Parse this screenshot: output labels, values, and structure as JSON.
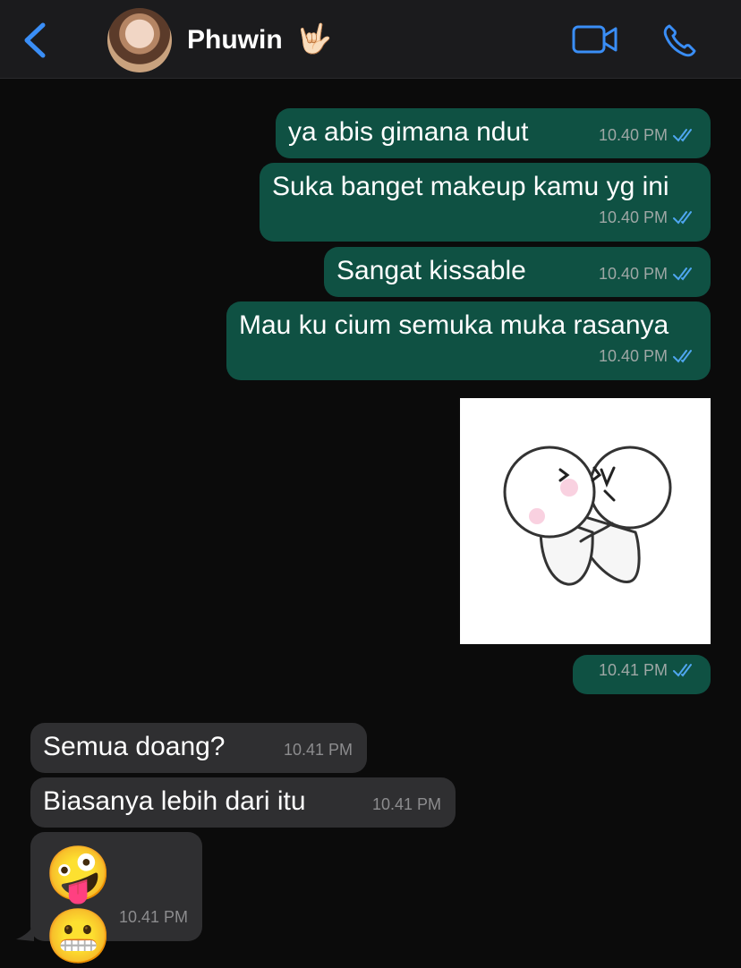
{
  "header": {
    "contact_name": "Phuwin",
    "contact_emoji": "🤟🏻",
    "icons": {
      "back": "back-chevron-icon",
      "video": "video-call-icon",
      "phone": "voice-call-icon"
    },
    "accent_color": "#3a8ef6"
  },
  "messages": [
    {
      "direction": "outgoing",
      "text": "ya abis gimana ndut",
      "time": "10.40 PM",
      "status": "read"
    },
    {
      "direction": "outgoing",
      "text": "Suka banget makeup kamu yg ini",
      "time": "10.40 PM",
      "status": "read"
    },
    {
      "direction": "outgoing",
      "text": "Sangat kissable",
      "time": "10.40 PM",
      "status": "read"
    },
    {
      "direction": "outgoing",
      "text": "Mau ku cium semuka muka rasanya",
      "time": "10.40 PM",
      "status": "read"
    },
    {
      "direction": "outgoing",
      "type": "sticker",
      "sticker": "kissing-characters-sticker",
      "time": "10.41 PM",
      "status": "read"
    },
    {
      "direction": "incoming",
      "text": "Semua doang?",
      "time": "10.41 PM"
    },
    {
      "direction": "incoming",
      "text": "Biasanya lebih dari itu",
      "time": "10.41 PM"
    },
    {
      "direction": "incoming",
      "text": "🤪 😬",
      "time": "10.41 PM"
    }
  ],
  "colors": {
    "outgoing_bubble": "#0f5143",
    "incoming_bubble": "#2f2f31",
    "read_ticks": "#4fa6f0"
  }
}
